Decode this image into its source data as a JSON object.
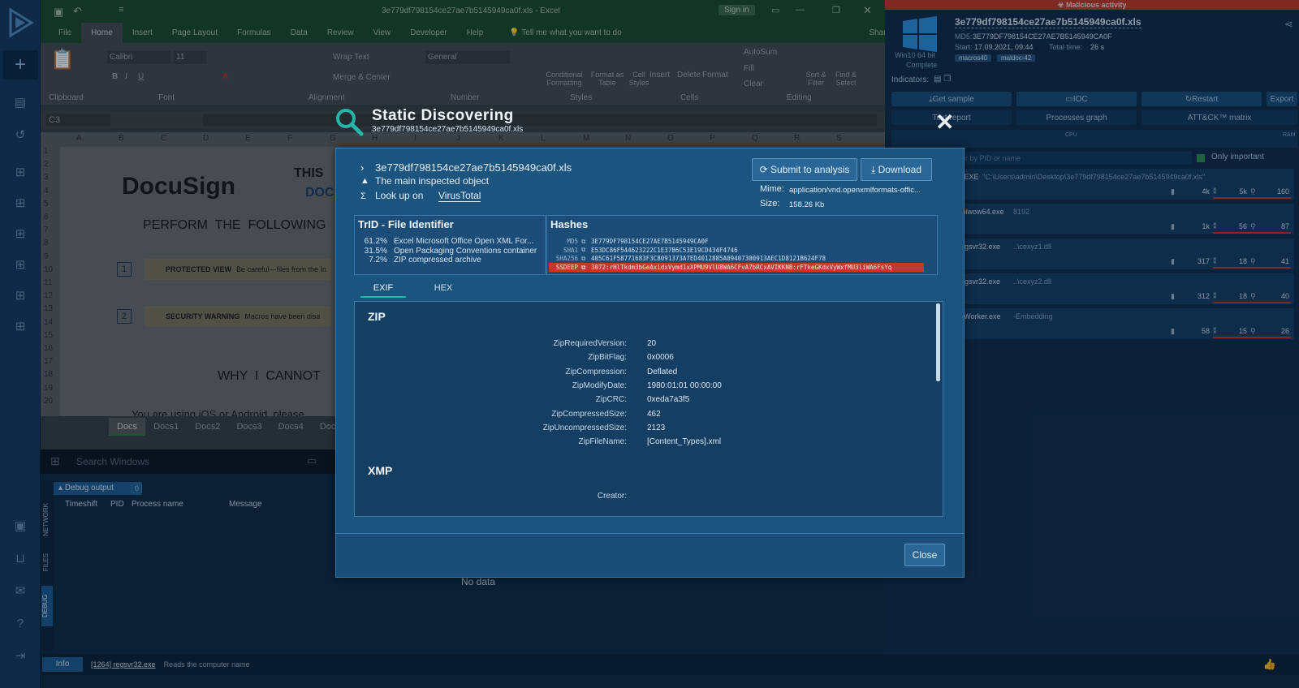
{
  "excel": {
    "title": "3e779df798154ce27ae7b5145949ca0f.xls  -  Excel",
    "signin": "Sign in",
    "tabs": [
      "File",
      "Home",
      "Insert",
      "Page Layout",
      "Formulas",
      "Data",
      "Review",
      "View",
      "Developer",
      "Help"
    ],
    "tell_me": "Tell me what you want to do",
    "share": "Share",
    "font_name": "Calibri",
    "font_size": "11",
    "wrap_text": "Wrap Text",
    "merge_center": "Merge & Center",
    "number_format": "General",
    "groups": [
      "Clipboard",
      "Font",
      "Alignment",
      "Number",
      "Styles",
      "Cells",
      "Editing"
    ],
    "styles_buttons": [
      "Conditional Formatting",
      "Format as Table",
      "Cell Styles"
    ],
    "cells_buttons": [
      "Insert",
      "Delete",
      "Format"
    ],
    "editing_buttons": [
      "AutoSum",
      "Fill",
      "Clear",
      "Sort & Filter",
      "Find & Select"
    ],
    "name_box": "C3",
    "columns": [
      "A",
      "B",
      "C",
      "D",
      "E",
      "F",
      "G",
      "H",
      "I",
      "J",
      "K",
      "L",
      "M",
      "N",
      "O",
      "P",
      "Q",
      "R",
      "S"
    ],
    "rows": [
      "1",
      "2",
      "3",
      "4",
      "5",
      "6",
      "7",
      "8",
      "9",
      "10",
      "11",
      "12",
      "13",
      "14",
      "15",
      "16",
      "17",
      "18",
      "19",
      "20"
    ],
    "doc_logo": "DocuSign",
    "doc_this": "THIS",
    "doc_doc": "DOC",
    "doc_perform": "PERFORM  THE  FOLLOWING",
    "step1_num": "1",
    "step1_text": "PROTECTED VIEW",
    "step1_sub": "Be careful—files from the In",
    "step2_num": "2",
    "step2_text": "SECURITY WARNING",
    "step2_sub": "Macros have been disa",
    "why": "WHY  I  CANNOT",
    "you_are": "You are using iOS or Android, please",
    "sheets": [
      "Docs",
      "Docs1",
      "Docs2",
      "Docs3",
      "Docs4",
      "Docs"
    ]
  },
  "taskbar": {
    "search": "Search Windows"
  },
  "debug": {
    "title": "Debug output",
    "count": "0",
    "columns": [
      "Timeshift",
      "PID",
      "Process name",
      "Message"
    ],
    "empty": "No data",
    "side_tabs": [
      "NETWORK",
      "FILES",
      "DEBUG"
    ]
  },
  "statusbar": {
    "level": "Info",
    "process": "[1264] regsvr32.exe",
    "message": "Reads the computer name"
  },
  "right": {
    "banner": "Malicious activity",
    "filename": "3e779df798154ce27ae7b5145949ca0f.xls",
    "md5_label": "MD5:",
    "md5": "3E779DF798154CE27AE7B5145949CA0F",
    "start_label": "Start:",
    "start": "17.09.2021, 09:44",
    "total_label": "Total time:",
    "total": "26 s",
    "tags": [
      "macros40",
      "maldoc-42"
    ],
    "os": "Win10 64 bit",
    "os_status": "Complete",
    "indicators": "Indicators:",
    "buttons1": [
      "Get sample",
      "IOC",
      "Restart",
      "Export"
    ],
    "buttons2": [
      "Text report",
      "Processes graph",
      "ATT&CK™ matrix"
    ],
    "cpu": "CPU",
    "ram": "RAM",
    "filter_placeholder": "Filter by PID or name",
    "only_important": "Only important",
    "processes": [
      {
        "name": "L.EXE",
        "args": "\"C:\\Users\\admin\\Desktop\\3e779df798154ce27ae7b5145949ca0f.xls\"",
        "files": "4k",
        "reg": "5k",
        "net": "160"
      },
      {
        "name": "splwow64.exe",
        "args": "8192",
        "files": "1k",
        "reg": "56",
        "net": "87"
      },
      {
        "name": "regsvr32.exe",
        "args": "..\\cexyz1.dll",
        "files": "317",
        "reg": "18",
        "net": "41"
      },
      {
        "name": "regsvr32.exe",
        "args": "..\\cexyz2.dll",
        "files": "312",
        "reg": "18",
        "net": "40"
      },
      {
        "name": "TiWorker.exe",
        "args": "-Embedding",
        "files": "58",
        "reg": "15",
        "net": "26"
      }
    ]
  },
  "modal": {
    "heading": "Static Discovering",
    "subheading": "3e779df798154ce27ae7b5145949ca0f.xls",
    "filename": "3e779df798154ce27ae7b5145949ca0f.xls",
    "main_object": "The main inspected object",
    "lookup": "Look up on ",
    "lookup_link": "VirusTotal",
    "submit": "Submit to analysis",
    "download": "Download",
    "mime_label": "Mime:",
    "mime": "application/vnd.openxmlformats-offic...",
    "size_label": "Size:",
    "size": "158.26 Kb",
    "trid_title": "TrID - File Identifier",
    "trid": [
      {
        "pct": "61.2%",
        "desc": "Excel Microsoft Office Open XML For..."
      },
      {
        "pct": "31.5%",
        "desc": "Open Packaging Conventions container"
      },
      {
        "pct": "7.2%",
        "desc": "ZIP compressed archive"
      }
    ],
    "hashes_title": "Hashes",
    "hashes": [
      {
        "k": "MD5",
        "v": "3E779DF798154CE27AE7B5145949CA0F"
      },
      {
        "k": "SHA1",
        "v": "E53DC86F544623222C1E37B6C53E19CD434F4746"
      },
      {
        "k": "SHA256",
        "v": "405C61F58771683F3C8091373A7ED4012885A09407300913AEC1D8121B624F78"
      },
      {
        "k": "SSDEEP",
        "v": "3072:rHlTkdm3bGeAxidxVymd1xXPMU9VlU8WA6CFvA7bRCxAVIKKNB:rFTkeGKdxVyWxfMU3liWA6FsYq"
      }
    ],
    "tabs": [
      "EXIF",
      "HEX"
    ],
    "zip_title": "ZIP",
    "zip": [
      {
        "k": "ZipRequiredVersion:",
        "v": "20"
      },
      {
        "k": "ZipBitFlag:",
        "v": "0x0006"
      },
      {
        "k": "ZipCompression:",
        "v": "Deflated"
      },
      {
        "k": "ZipModifyDate:",
        "v": "1980:01:01 00:00:00"
      },
      {
        "k": "ZipCRC:",
        "v": "0xeda7a3f5"
      },
      {
        "k": "ZipCompressedSize:",
        "v": "462"
      },
      {
        "k": "ZipUncompressedSize:",
        "v": "2123"
      },
      {
        "k": "ZipFileName:",
        "v": "[Content_Types].xml"
      }
    ],
    "xmp_title": "XMP",
    "xmp": [
      {
        "k": "Creator:",
        "v": ""
      }
    ],
    "close": "Close"
  },
  "colors": {
    "accent": "#1f8fd6",
    "danger": "#c0392b",
    "modal_bg": "#1c5480",
    "teal_icon": "#25b5a9"
  }
}
